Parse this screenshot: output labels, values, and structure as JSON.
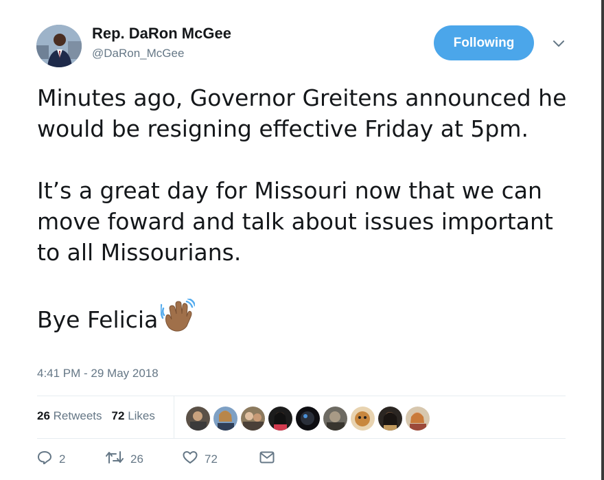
{
  "author": {
    "name": "Rep. DaRon McGee",
    "handle": "@DaRon_McGee"
  },
  "follow_button": {
    "label": "Following",
    "color": "#4ba6ea"
  },
  "tweet": {
    "paragraphs": [
      "Minutes ago, Governor Greitens announced he would be resigning effective Friday at 5pm.",
      "It’s a great day for Missouri now that we can move foward and talk about issues important to all Missourians.",
      "Bye Felicia"
    ],
    "emoji": "waving-hand-icon"
  },
  "timestamp": "4:41 PM - 29 May 2018",
  "stats": {
    "retweets_count": "26",
    "retweets_label": "Retweets",
    "likes_count": "72",
    "likes_label": "Likes"
  },
  "actions": {
    "reply_count": "2",
    "retweet_count": "26",
    "like_count": "72"
  },
  "colors": {
    "text": "#14171a",
    "secondary": "#657786",
    "divider": "#e6ecf0"
  }
}
